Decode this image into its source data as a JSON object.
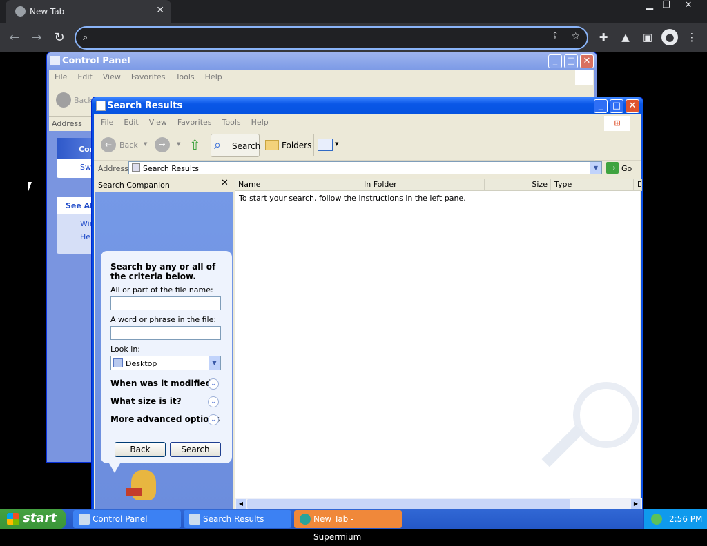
{
  "browser": {
    "tab_title": "New Tab",
    "omnibox_value": ""
  },
  "control_panel": {
    "title": "Control Panel",
    "menu": [
      "File",
      "Edit",
      "View",
      "Favorites",
      "Tools",
      "Help"
    ],
    "back_label": "Back",
    "address_label": "Address",
    "side_panel_title": "Control Panel",
    "switch_label": "Switch to Classic View",
    "see_also": "See Also",
    "see_also_items": [
      "Windows Update",
      "Help and Support"
    ]
  },
  "search_results": {
    "title": "Search Results",
    "menu": [
      "File",
      "Edit",
      "View",
      "Favorites",
      "Tools",
      "Help"
    ],
    "toolbar": {
      "back": "Back",
      "search": "Search",
      "folders": "Folders"
    },
    "address_label": "Address",
    "address_value": "Search Results",
    "go_label": "Go",
    "companion_title": "Search Companion",
    "columns": [
      "Name",
      "In Folder",
      "Size",
      "Type",
      "D"
    ],
    "empty_message": "To start your search, follow the instructions in the left pane.",
    "panel": {
      "heading": "Search by any or all of the criteria below.",
      "file_name_label": "All or part of the file name:",
      "word_label": "A word or phrase in the file:",
      "look_in_label": "Look in:",
      "look_in_value": "Desktop",
      "options": [
        "When was it modified?",
        "What size is it?",
        "More advanced options"
      ],
      "back_button": "Back",
      "search_button": "Search"
    }
  },
  "taskbar": {
    "start": "start",
    "tasks": [
      "Control Panel",
      "Search Results",
      "New Tab - Supermium"
    ],
    "clock": "2:56 PM"
  }
}
